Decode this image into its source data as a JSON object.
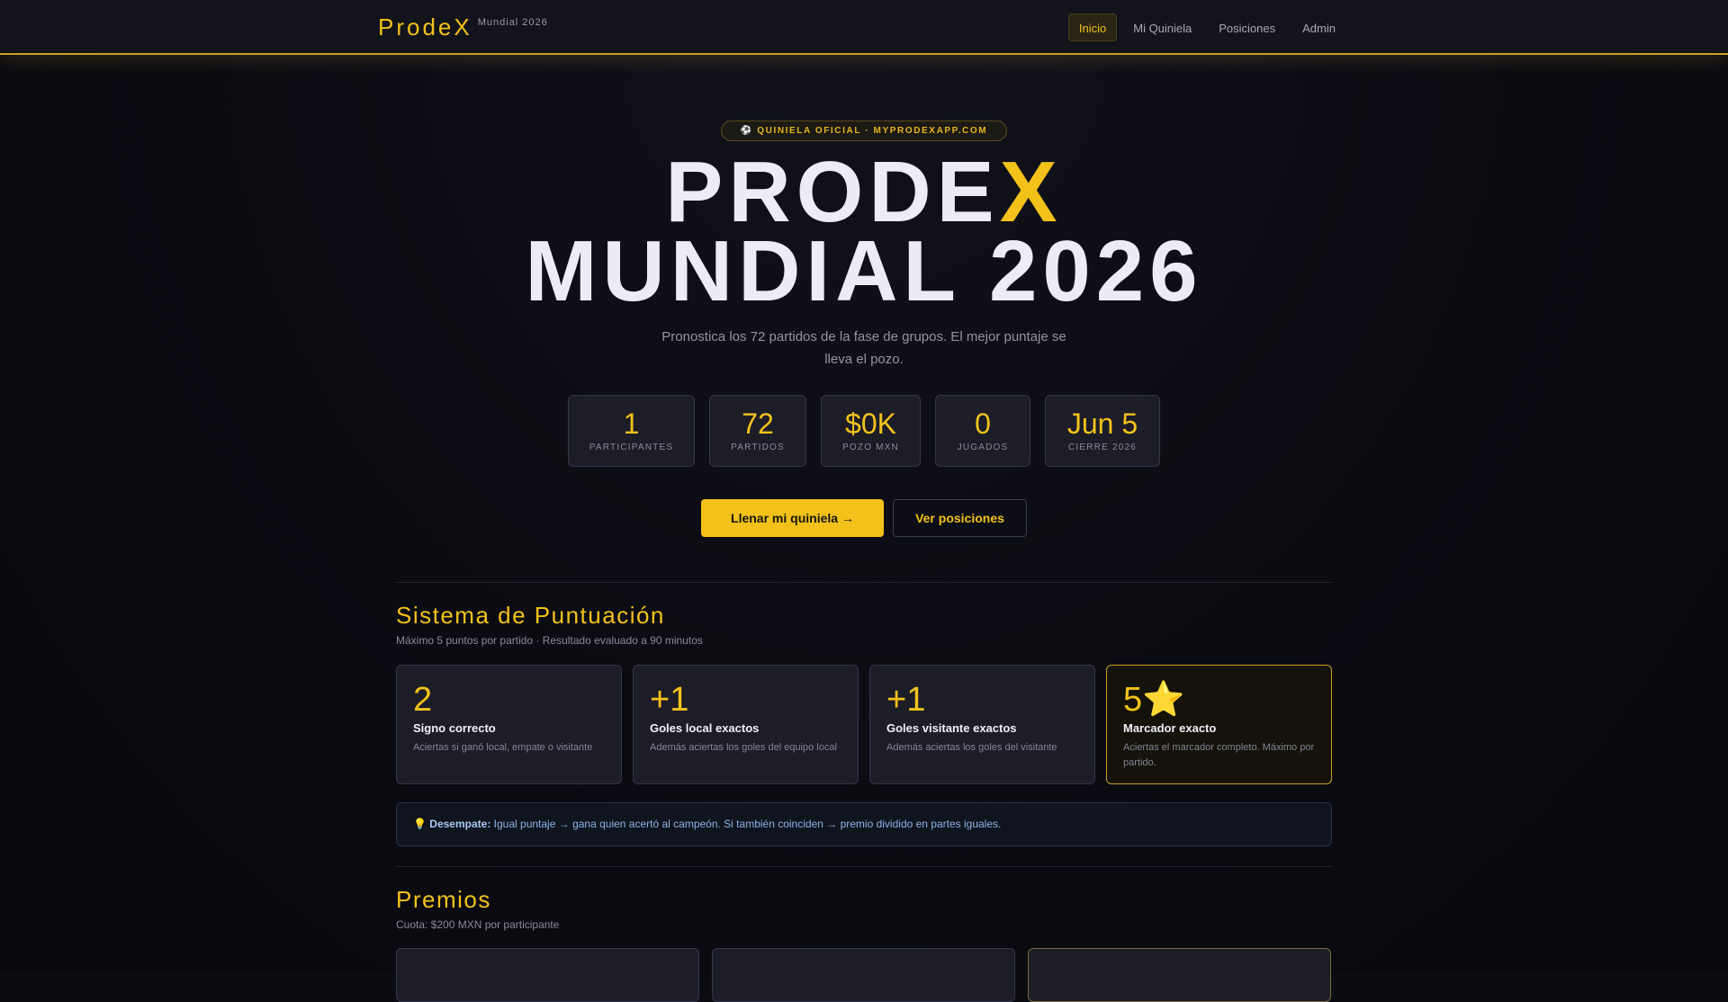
{
  "nav": {
    "brand": "ProdeX",
    "brand_sub": "Mundial 2026",
    "items": [
      {
        "label": "Inicio",
        "active": true
      },
      {
        "label": "Mi Quiniela",
        "active": false
      },
      {
        "label": "Posiciones",
        "active": false
      },
      {
        "label": "Admin",
        "active": false
      }
    ]
  },
  "hero": {
    "badge": "⚽ QUINIELA OFICIAL · MYPRODEXAPP.COM",
    "title_part1": "PRODE",
    "title_accent": "X",
    "title_line2": "MUNDIAL 2026",
    "description": "Pronostica los 72 partidos de la fase de grupos. El mejor puntaje se lleva el pozo."
  },
  "stats": [
    {
      "value": "1",
      "label": "PARTICIPANTES"
    },
    {
      "value": "72",
      "label": "PARTIDOS"
    },
    {
      "value": "$0K",
      "label": "POZO MXN"
    },
    {
      "value": "0",
      "label": "JUGADOS"
    },
    {
      "value": "Jun 5",
      "label": "CIERRE 2026"
    }
  ],
  "actions": {
    "primary": "Llenar mi quiniela →",
    "secondary": "Ver posiciones"
  },
  "scoring": {
    "title": "Sistema de Puntuación",
    "subtitle": "Máximo 5 puntos por partido · Resultado evaluado a 90 minutos",
    "cards": [
      {
        "points": "2",
        "name": "Signo correcto",
        "desc": "Aciertas si ganó local, empate o visitante"
      },
      {
        "points": "+1",
        "name": "Goles local exactos",
        "desc": "Además aciertas los goles del equipo local"
      },
      {
        "points": "+1",
        "name": "Goles visitante exactos",
        "desc": "Además aciertas los goles del visitante"
      },
      {
        "points": "5⭐",
        "name": "Marcador exacto",
        "desc": "Aciertas el marcador completo. Máximo por partido."
      }
    ],
    "tiebreak_icon": "💡",
    "tiebreak_label": "Desempate:",
    "tiebreak_text": "Igual puntaje → gana quien acertó al campeón. Si también coinciden → premio dividido en partes iguales."
  },
  "prizes": {
    "title": "Premios",
    "subtitle": "Cuota: $200 MXN por participante"
  },
  "colors": {
    "accent": "#f2c21b",
    "background": "#0b0b12",
    "card": "#1d1d28",
    "info": "#8eb4e8"
  }
}
